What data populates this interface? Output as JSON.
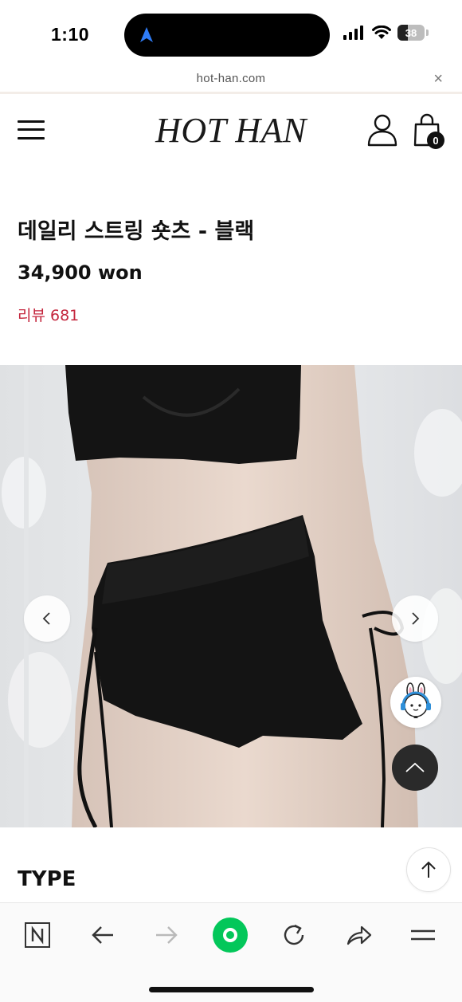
{
  "status_bar": {
    "time": "1:10",
    "battery": "38",
    "battery_level": 0.38
  },
  "browser": {
    "url": "hot-han.com",
    "close_symbol": "×"
  },
  "header": {
    "logo": "HOT HAN",
    "cart_count": "0"
  },
  "product": {
    "title": "데일리 스트링 숏츠 - 블랙",
    "price": "34,900 won",
    "review": "리뷰 681"
  },
  "section": {
    "type_heading": "TYPE"
  },
  "colors": {
    "accent_review": "#c4263d",
    "active_tab": "#03c75a",
    "text_primary": "#111111"
  },
  "icons": {
    "status": [
      "location-arrow-icon",
      "signal-icon",
      "wifi-icon",
      "battery-icon"
    ],
    "header": [
      "menu-icon",
      "user-icon",
      "shopping-bag-icon"
    ],
    "overlay": [
      "chevron-left-icon",
      "chevron-right-icon",
      "chatbot-bunny-icon",
      "chevron-up-icon",
      "arrow-up-icon"
    ],
    "toolbar": [
      "naver-n-icon",
      "back-arrow-icon",
      "forward-arrow-icon",
      "home-circle-icon",
      "refresh-icon",
      "share-icon",
      "menu-lines-icon"
    ]
  }
}
